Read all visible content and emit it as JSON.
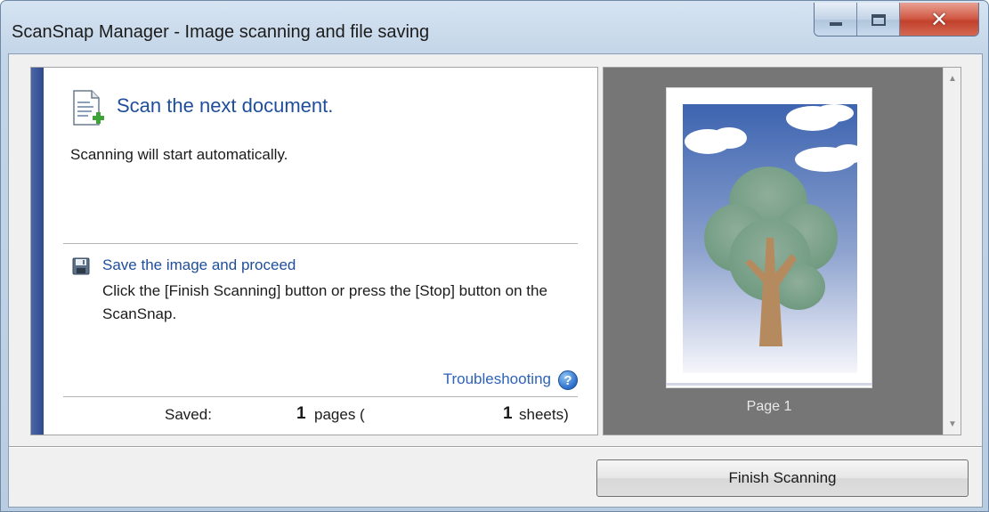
{
  "window": {
    "title": "ScanSnap Manager - Image scanning and file saving"
  },
  "main": {
    "heading": "Scan the next document.",
    "subtext": "Scanning will start automatically.",
    "save_link": "Save the image and proceed",
    "save_description": "Click the [Finish Scanning] button or press the [Stop] button on the ScanSnap.",
    "troubleshooting": "Troubleshooting",
    "help_icon": "?",
    "saved_label": "Saved:",
    "pages_count": "1",
    "pages_unit": "pages (",
    "sheets_count": "1",
    "sheets_unit": "sheets)"
  },
  "preview": {
    "page_label": "Page 1"
  },
  "footer": {
    "finish_button": "Finish Scanning"
  },
  "icons": {
    "document": "document-add-icon",
    "save": "floppy-disk-icon",
    "help": "help-icon",
    "minimize": "minimize-icon",
    "maximize": "maximize-icon",
    "close": "close-icon"
  },
  "colors": {
    "accent_strip": "#2f4a8c",
    "link": "#1f4e9c",
    "close_button": "#c2412c",
    "preview_background": "#767676"
  }
}
